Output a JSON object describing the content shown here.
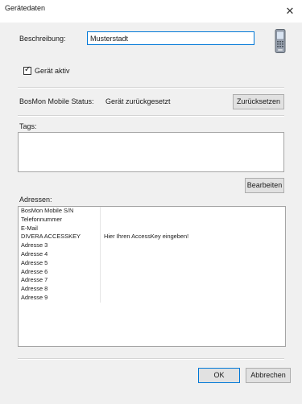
{
  "window": {
    "title": "Gerätedaten",
    "close_glyph": "✕"
  },
  "description": {
    "label": "Beschreibung:",
    "value": "Musterstadt"
  },
  "device_active": {
    "label": "Gerät aktiv",
    "checked": true
  },
  "status": {
    "label": "BosMon Mobile Status:",
    "value": "Gerät zurückgesetzt",
    "reset_button": "Zurücksetzen"
  },
  "tags": {
    "label": "Tags:",
    "edit_button": "Bearbeiten"
  },
  "addresses": {
    "label": "Adressen:",
    "rows": [
      {
        "name": "BosMon Mobile S/N",
        "value": ""
      },
      {
        "name": "Telefonnummer",
        "value": ""
      },
      {
        "name": "E-Mail",
        "value": ""
      },
      {
        "name": "DIVERA ACCESSKEY",
        "value": "Hier Ihren AccessKey eingeben!"
      },
      {
        "name": "Adresse 3",
        "value": ""
      },
      {
        "name": "Adresse 4",
        "value": ""
      },
      {
        "name": "Adresse 5",
        "value": ""
      },
      {
        "name": "Adresse 6",
        "value": ""
      },
      {
        "name": "Adresse 7",
        "value": ""
      },
      {
        "name": "Adresse 8",
        "value": ""
      },
      {
        "name": "Adresse 9",
        "value": ""
      }
    ]
  },
  "footer": {
    "ok_button": "OK",
    "cancel_button": "Abbrechen"
  },
  "icons": {
    "device": "mobile-device-icon",
    "close": "close-icon",
    "checkmark": "checkmark-icon"
  },
  "colors": {
    "focus_border": "#0078d7",
    "dialog_bg": "#f0f0f0",
    "button_bg": "#e1e1e1"
  }
}
